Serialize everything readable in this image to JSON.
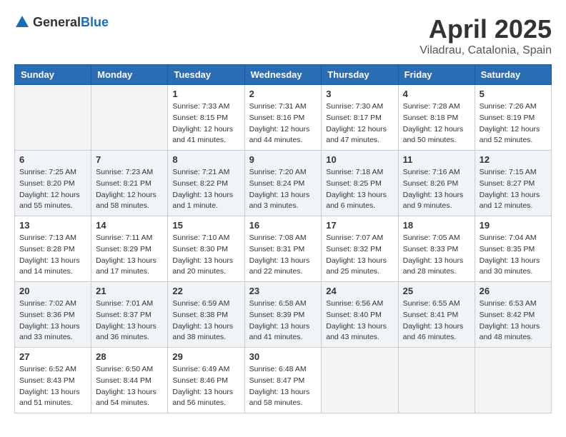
{
  "header": {
    "logo_general": "General",
    "logo_blue": "Blue",
    "month_year": "April 2025",
    "location": "Viladrau, Catalonia, Spain"
  },
  "weekdays": [
    "Sunday",
    "Monday",
    "Tuesday",
    "Wednesday",
    "Thursday",
    "Friday",
    "Saturday"
  ],
  "weeks": [
    [
      {
        "day": "",
        "info": ""
      },
      {
        "day": "",
        "info": ""
      },
      {
        "day": "1",
        "info": "Sunrise: 7:33 AM\nSunset: 8:15 PM\nDaylight: 12 hours and 41 minutes."
      },
      {
        "day": "2",
        "info": "Sunrise: 7:31 AM\nSunset: 8:16 PM\nDaylight: 12 hours and 44 minutes."
      },
      {
        "day": "3",
        "info": "Sunrise: 7:30 AM\nSunset: 8:17 PM\nDaylight: 12 hours and 47 minutes."
      },
      {
        "day": "4",
        "info": "Sunrise: 7:28 AM\nSunset: 8:18 PM\nDaylight: 12 hours and 50 minutes."
      },
      {
        "day": "5",
        "info": "Sunrise: 7:26 AM\nSunset: 8:19 PM\nDaylight: 12 hours and 52 minutes."
      }
    ],
    [
      {
        "day": "6",
        "info": "Sunrise: 7:25 AM\nSunset: 8:20 PM\nDaylight: 12 hours and 55 minutes."
      },
      {
        "day": "7",
        "info": "Sunrise: 7:23 AM\nSunset: 8:21 PM\nDaylight: 12 hours and 58 minutes."
      },
      {
        "day": "8",
        "info": "Sunrise: 7:21 AM\nSunset: 8:22 PM\nDaylight: 13 hours and 1 minute."
      },
      {
        "day": "9",
        "info": "Sunrise: 7:20 AM\nSunset: 8:24 PM\nDaylight: 13 hours and 3 minutes."
      },
      {
        "day": "10",
        "info": "Sunrise: 7:18 AM\nSunset: 8:25 PM\nDaylight: 13 hours and 6 minutes."
      },
      {
        "day": "11",
        "info": "Sunrise: 7:16 AM\nSunset: 8:26 PM\nDaylight: 13 hours and 9 minutes."
      },
      {
        "day": "12",
        "info": "Sunrise: 7:15 AM\nSunset: 8:27 PM\nDaylight: 13 hours and 12 minutes."
      }
    ],
    [
      {
        "day": "13",
        "info": "Sunrise: 7:13 AM\nSunset: 8:28 PM\nDaylight: 13 hours and 14 minutes."
      },
      {
        "day": "14",
        "info": "Sunrise: 7:11 AM\nSunset: 8:29 PM\nDaylight: 13 hours and 17 minutes."
      },
      {
        "day": "15",
        "info": "Sunrise: 7:10 AM\nSunset: 8:30 PM\nDaylight: 13 hours and 20 minutes."
      },
      {
        "day": "16",
        "info": "Sunrise: 7:08 AM\nSunset: 8:31 PM\nDaylight: 13 hours and 22 minutes."
      },
      {
        "day": "17",
        "info": "Sunrise: 7:07 AM\nSunset: 8:32 PM\nDaylight: 13 hours and 25 minutes."
      },
      {
        "day": "18",
        "info": "Sunrise: 7:05 AM\nSunset: 8:33 PM\nDaylight: 13 hours and 28 minutes."
      },
      {
        "day": "19",
        "info": "Sunrise: 7:04 AM\nSunset: 8:35 PM\nDaylight: 13 hours and 30 minutes."
      }
    ],
    [
      {
        "day": "20",
        "info": "Sunrise: 7:02 AM\nSunset: 8:36 PM\nDaylight: 13 hours and 33 minutes."
      },
      {
        "day": "21",
        "info": "Sunrise: 7:01 AM\nSunset: 8:37 PM\nDaylight: 13 hours and 36 minutes."
      },
      {
        "day": "22",
        "info": "Sunrise: 6:59 AM\nSunset: 8:38 PM\nDaylight: 13 hours and 38 minutes."
      },
      {
        "day": "23",
        "info": "Sunrise: 6:58 AM\nSunset: 8:39 PM\nDaylight: 13 hours and 41 minutes."
      },
      {
        "day": "24",
        "info": "Sunrise: 6:56 AM\nSunset: 8:40 PM\nDaylight: 13 hours and 43 minutes."
      },
      {
        "day": "25",
        "info": "Sunrise: 6:55 AM\nSunset: 8:41 PM\nDaylight: 13 hours and 46 minutes."
      },
      {
        "day": "26",
        "info": "Sunrise: 6:53 AM\nSunset: 8:42 PM\nDaylight: 13 hours and 48 minutes."
      }
    ],
    [
      {
        "day": "27",
        "info": "Sunrise: 6:52 AM\nSunset: 8:43 PM\nDaylight: 13 hours and 51 minutes."
      },
      {
        "day": "28",
        "info": "Sunrise: 6:50 AM\nSunset: 8:44 PM\nDaylight: 13 hours and 54 minutes."
      },
      {
        "day": "29",
        "info": "Sunrise: 6:49 AM\nSunset: 8:46 PM\nDaylight: 13 hours and 56 minutes."
      },
      {
        "day": "30",
        "info": "Sunrise: 6:48 AM\nSunset: 8:47 PM\nDaylight: 13 hours and 58 minutes."
      },
      {
        "day": "",
        "info": ""
      },
      {
        "day": "",
        "info": ""
      },
      {
        "day": "",
        "info": ""
      }
    ]
  ]
}
